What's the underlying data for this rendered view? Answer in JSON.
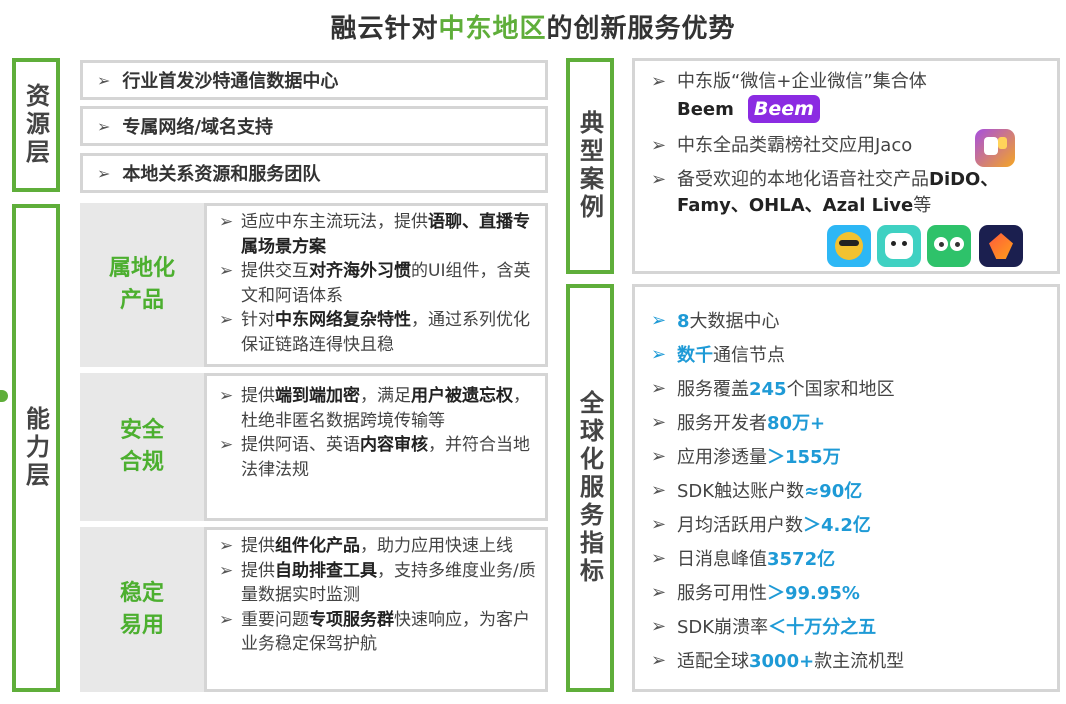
{
  "title": {
    "prefix": "融云针对",
    "highlight": "中东地区",
    "suffix": "的创新服务优势"
  },
  "resource_layer": {
    "label": "资源层",
    "items": [
      "行业首发沙特通信数据中心",
      "专属网络/域名支持",
      "本地关系资源和服务团队"
    ]
  },
  "capability_layer": {
    "label": "能力层",
    "sections": [
      {
        "title_line1": "属地化",
        "title_line2": "产品",
        "bullets": [
          {
            "a": "适应中东主流玩法，提供",
            "b": "语聊、直播专属场景方案",
            "c": ""
          },
          {
            "a": "提供交互",
            "b": "对齐海外习惯",
            "c": "的UI组件，含英文和阿语体系"
          },
          {
            "a": "针对",
            "b": "中东网络复杂特性",
            "c": "，通过系列优化保证链路连得快且稳"
          }
        ]
      },
      {
        "title_line1": "安全",
        "title_line2": "合规",
        "bullets": [
          {
            "a": "提供",
            "b": "端到端加密",
            "c": "，满足",
            "d": "用户被遗忘权",
            "e": "，杜绝非匿名数据跨境传输等"
          },
          {
            "a": "提供阿语、英语",
            "b": "内容审核",
            "c": "，并符合当地法律法规"
          }
        ]
      },
      {
        "title_line1": "稳定",
        "title_line2": "易用",
        "bullets": [
          {
            "a": "提供",
            "b": "组件化产品",
            "c": "，助力应用快速上线"
          },
          {
            "a": "提供",
            "b": "自助排查工具",
            "c": "，支持多维度业务/质量数据实时监测"
          },
          {
            "a": "重要问题",
            "b": "专项服务群",
            "c": "快速响应，为客户业务稳定保驾护航"
          }
        ]
      }
    ]
  },
  "cases": {
    "label": "典型案例",
    "line1": "中东版“微信+企业微信”集合体",
    "line1b": "Beem",
    "beem_logo": "Beem",
    "line2": "中东全品类霸榜社交应用Jaco",
    "line3a": "备受欢迎的本地化语音社交产品",
    "line3b": "DiDO、Famy、OHLA、Azal Live",
    "line3c": "等"
  },
  "global": {
    "label": "全球化服务指标",
    "stats": [
      {
        "pre": "",
        "num": "8",
        "post": "大数据中心",
        "blue_arrow": true
      },
      {
        "pre": "",
        "num": "数千",
        "post": "通信节点",
        "blue_arrow": true
      },
      {
        "pre": "服务覆盖",
        "num": "245",
        "post": "个国家和地区",
        "blue_arrow": false
      },
      {
        "pre": "服务开发者",
        "num": "80万+",
        "post": "",
        "blue_arrow": false
      },
      {
        "pre": "应用渗透量",
        "num": "＞155万",
        "post": "",
        "blue_arrow": false
      },
      {
        "pre": "SDK触达账户数",
        "num": "≈90亿",
        "post": "",
        "blue_arrow": false
      },
      {
        "pre": "月均活跃用户数",
        "num": "＞4.2亿",
        "post": "",
        "blue_arrow": false
      },
      {
        "pre": "日消息峰值",
        "num": "3572亿",
        "post": "",
        "blue_arrow": false
      },
      {
        "pre": "服务可用性",
        "num": "＞99.95%",
        "post": "",
        "blue_arrow": false
      },
      {
        "pre": "SDK崩溃率",
        "num": "＜十万分之五",
        "post": "",
        "blue_arrow": false
      },
      {
        "pre": "适配全球",
        "num": "3000+",
        "post": "款主流机型",
        "blue_arrow": false
      }
    ]
  },
  "colors": {
    "green": "#5fae3a",
    "blue": "#1e9ad6",
    "beem": "#8b2be2"
  }
}
